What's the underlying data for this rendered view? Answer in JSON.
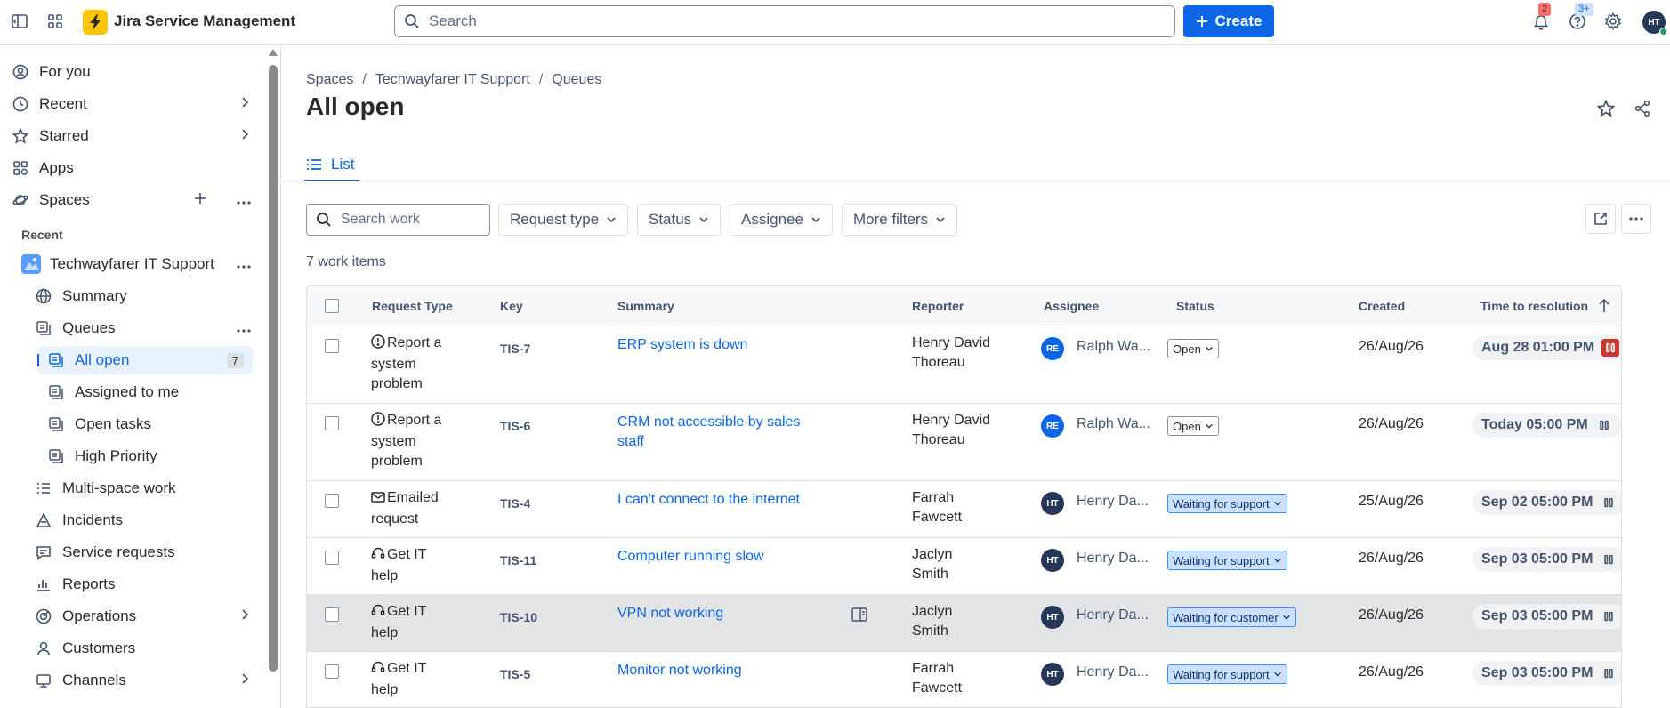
{
  "app": {
    "title": "Jira Service Management",
    "search_placeholder": "Search",
    "create_label": "Create",
    "notifications_count": "2",
    "help_count": "3+",
    "user_initials": "HT"
  },
  "sidebar": {
    "top_items": [
      {
        "label": "For you",
        "icon": "person-circle-icon"
      },
      {
        "label": "Recent",
        "icon": "clock-icon"
      },
      {
        "label": "Starred",
        "icon": "star-icon"
      },
      {
        "label": "Apps",
        "icon": "apps-icon"
      },
      {
        "label": "Spaces",
        "icon": "spaces-icon"
      }
    ],
    "recent_label": "Recent",
    "space_name": "Techwayfarer IT Support",
    "space_items": [
      {
        "label": "Summary",
        "icon": "globe-icon"
      },
      {
        "label": "Queues",
        "icon": "queue-icon"
      }
    ],
    "queue_items": [
      {
        "label": "All open",
        "count": "7",
        "selected": true
      },
      {
        "label": "Assigned to me"
      },
      {
        "label": "Open tasks"
      },
      {
        "label": "High Priority"
      }
    ],
    "other_items": [
      {
        "label": "Multi-space work",
        "icon": "list-icon"
      },
      {
        "label": "Incidents",
        "icon": "incident-icon"
      },
      {
        "label": "Service requests",
        "icon": "chat-icon"
      },
      {
        "label": "Reports",
        "icon": "chart-icon"
      },
      {
        "label": "Operations",
        "icon": "operations-icon"
      },
      {
        "label": "Customers",
        "icon": "person-icon"
      },
      {
        "label": "Channels",
        "icon": "monitor-icon"
      }
    ]
  },
  "breadcrumb": [
    "Spaces",
    "Techwayfarer IT Support",
    "Queues"
  ],
  "page_title": "All open",
  "tab_label": "List",
  "filters": {
    "search_placeholder": "Search work",
    "buttons": [
      "Request type",
      "Status",
      "Assignee",
      "More filters"
    ]
  },
  "work_count": "7 work items",
  "table": {
    "headers": [
      "Request Type",
      "Key",
      "Summary",
      "Reporter",
      "Assignee",
      "Status",
      "Created",
      "Time to resolution"
    ],
    "rows": [
      {
        "request_type": "Report a system problem",
        "rt_icon": "alert-icon",
        "key": "TIS-7",
        "summary": "ERP system is down",
        "reporter": "Henry David Thoreau",
        "assignee_initials": "RE",
        "assignee": "Ralph Wa...",
        "assignee_color": "#0c66e4",
        "status": "Open",
        "created": "26/Aug/26",
        "ttr": "Aug 28 01:00 PM",
        "breached": true
      },
      {
        "request_type": "Report a system problem",
        "rt_icon": "alert-icon",
        "key": "TIS-6",
        "summary": "CRM not accessible by sales staff",
        "reporter": "Henry David Thoreau",
        "assignee_initials": "RE",
        "assignee": "Ralph Wa...",
        "assignee_color": "#0c66e4",
        "status": "Open",
        "created": "26/Aug/26",
        "ttr": "Today 05:00 PM",
        "breached": false
      },
      {
        "request_type": "Emailed request",
        "rt_icon": "mail-icon",
        "key": "TIS-4",
        "summary": "I can't connect to the internet",
        "reporter": "Farrah Fawcett",
        "assignee_initials": "HT",
        "assignee": "Henry Da...",
        "assignee_color": "#253858",
        "status": "Waiting for support",
        "created": "25/Aug/26",
        "ttr": "Sep 02 05:00 PM",
        "breached": false
      },
      {
        "request_type": "Get IT help",
        "rt_icon": "headset-icon",
        "key": "TIS-11",
        "summary": "Computer running slow",
        "reporter": "Jaclyn Smith",
        "assignee_initials": "HT",
        "assignee": "Henry Da...",
        "assignee_color": "#253858",
        "status": "Waiting for support",
        "created": "26/Aug/26",
        "ttr": "Sep 03 05:00 PM",
        "breached": false
      },
      {
        "request_type": "Get IT help",
        "rt_icon": "headset-icon",
        "key": "TIS-10",
        "summary": "VPN not working",
        "reporter": "Jaclyn Smith",
        "assignee_initials": "HT",
        "assignee": "Henry Da...",
        "assignee_color": "#253858",
        "status": "Waiting for customer",
        "created": "26/Aug/26",
        "ttr": "Sep 03 05:00 PM",
        "breached": false
      },
      {
        "request_type": "Get IT help",
        "rt_icon": "headset-icon",
        "key": "TIS-5",
        "summary": "Monitor not working",
        "reporter": "Farrah Fawcett",
        "assignee_initials": "HT",
        "assignee": "Henry Da...",
        "assignee_color": "#253858",
        "status": "Waiting for support",
        "created": "26/Aug/26",
        "ttr": "Sep 03 05:00 PM",
        "breached": false
      }
    ]
  }
}
